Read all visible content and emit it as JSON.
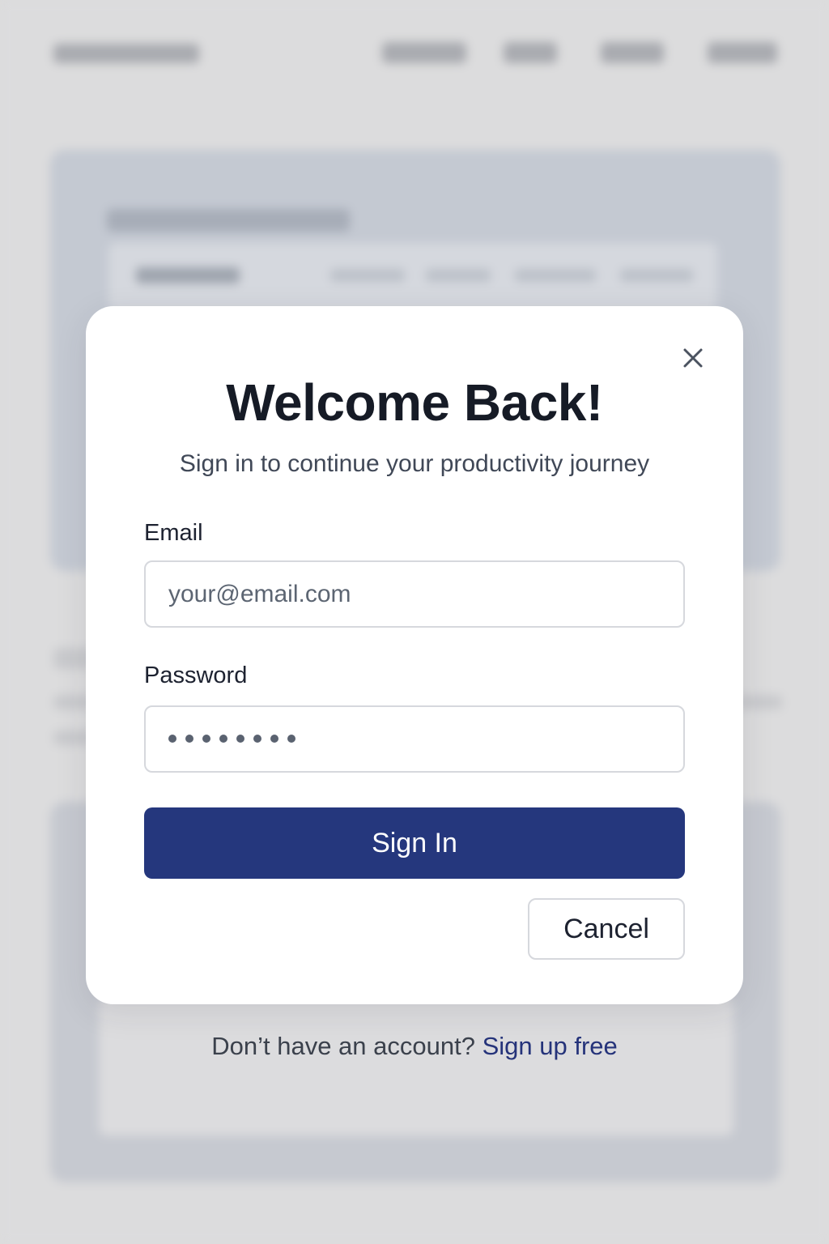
{
  "modal": {
    "title": "Welcome Back!",
    "subtitle": "Sign in to continue your productivity journey",
    "close_icon": "close-icon",
    "email": {
      "label": "Email",
      "placeholder": "your@email.com",
      "value": ""
    },
    "password": {
      "label": "Password",
      "masked_length": 8
    },
    "signin_label": "Sign In",
    "cancel_label": "Cancel"
  },
  "footer": {
    "prompt_text": "Don’t have an account?",
    "signup_link": "Sign up free"
  },
  "colors": {
    "primary": "#25377d",
    "link": "#25337a",
    "title": "#161b26",
    "overlay_bg": "#dcdcdd"
  }
}
